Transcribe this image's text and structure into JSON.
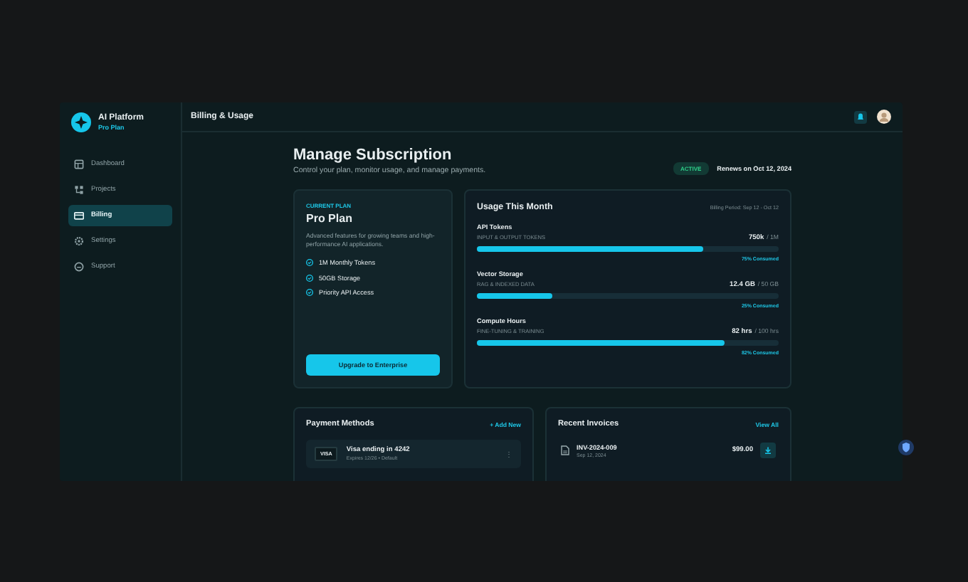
{
  "sidebar": {
    "brand": {
      "name": "AI Platform",
      "plan": "Pro Plan"
    },
    "items": [
      {
        "label": "Dashboard",
        "selected": false
      },
      {
        "label": "Projects",
        "selected": false
      },
      {
        "label": "Billing",
        "selected": true
      },
      {
        "label": "Settings",
        "selected": false
      },
      {
        "label": "Support",
        "selected": false
      }
    ]
  },
  "header": {
    "title": "Billing & Usage"
  },
  "page": {
    "title": "Manage Subscription",
    "subtitle": "Control your plan, monitor usage, and manage payments.",
    "status": "ACTIVE",
    "renews": "Renews on Oct 12, 2024"
  },
  "plan": {
    "eyebrow": "CURRENT PLAN",
    "name": "Pro Plan",
    "description": "Advanced features for growing teams and high-performance AI applications.",
    "features": [
      "1M Monthly Tokens",
      "50GB Storage",
      "Priority API Access"
    ],
    "button": "Upgrade to Enterprise"
  },
  "usage": {
    "title": "Usage This Month",
    "period": "Billing Period: Sep 12 - Oct 12",
    "metrics": [
      {
        "name": "API Tokens",
        "sub": "INPUT & OUTPUT TOKENS",
        "value": "750k",
        "limit": "/ 1M",
        "level": 0.75,
        "consumed": "75% Consumed"
      },
      {
        "name": "Vector Storage",
        "sub": "RAG & INDEXED DATA",
        "value": "12.4 GB",
        "limit": "/ 50 GB",
        "level": 0.25,
        "consumed": "25% Consumed"
      },
      {
        "name": "Compute Hours",
        "sub": "FINE-TUNING & TRAINING",
        "value": "82 hrs",
        "limit": "/ 100 hrs",
        "level": 0.82,
        "consumed": "82% Consumed"
      }
    ]
  },
  "payment": {
    "title": "Payment Methods",
    "action": "+ Add New",
    "methods": [
      {
        "brand": "VISA",
        "name": "Visa ending in 4242",
        "detail": "Expires 12/26 • Default",
        "menu": "⋮"
      }
    ]
  },
  "invoices": {
    "title": "Recent Invoices",
    "action": "View All",
    "items": [
      {
        "id": "INV-2024-009",
        "date": "Sep 12, 2024",
        "amount": "$99.00"
      }
    ]
  }
}
